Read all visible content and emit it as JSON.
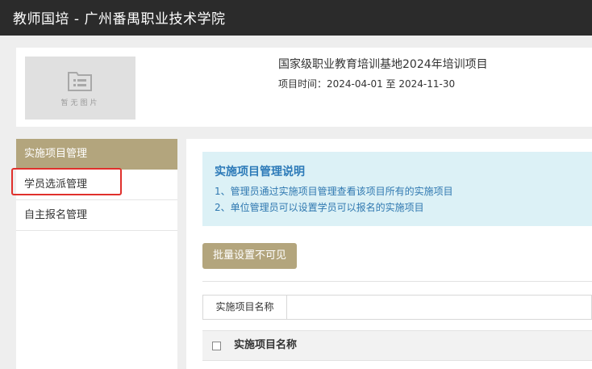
{
  "header": {
    "title": "教师国培 - 广州番禺职业技术学院"
  },
  "project": {
    "image_placeholder": "暂无图片",
    "name": "国家级职业教育培训基地2024年培训项目",
    "time": "项目时间：2024-04-01 至 2024-11-30"
  },
  "sidebar": {
    "header": "实施项目管理",
    "items": [
      {
        "label": "学员选派管理"
      },
      {
        "label": "自主报名管理"
      }
    ],
    "highlight_color": "#e0302c"
  },
  "main": {
    "info": {
      "title": "实施项目管理说明",
      "lines": [
        "1、管理员通过实施项目管理查看该项目所有的实施项目",
        "2、单位管理员可以设置学员可以报名的实施项目"
      ]
    },
    "batch_button": "批量设置不可见",
    "search": {
      "label": "实施项目名称",
      "value": "",
      "placeholder": ""
    },
    "table": {
      "columns": [
        "实施项目名称"
      ]
    }
  },
  "colors": {
    "header_bg": "#2b2b2b",
    "accent": "#b3a57d",
    "info_bg": "#dcf1f6",
    "info_text": "#2f78b0"
  }
}
